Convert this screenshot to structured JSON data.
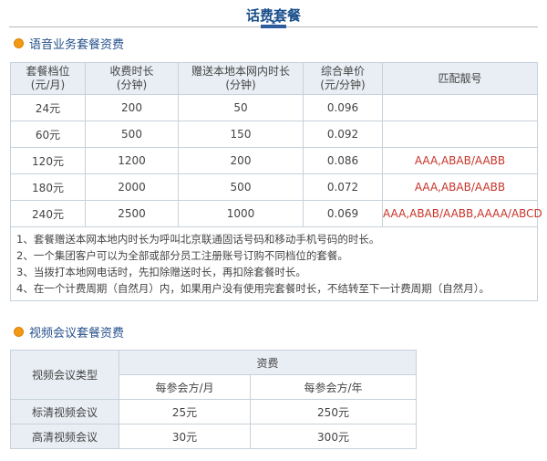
{
  "page_title": "话费套餐",
  "voice_section": {
    "title": "语音业务套餐资费",
    "headers": [
      [
        "套餐档位",
        "(元/月)"
      ],
      [
        "收费时长",
        "(分钟)"
      ],
      [
        "赠送本地本网内时长",
        "(分钟)"
      ],
      [
        "综合单价",
        "(元/分钟)"
      ],
      [
        "匹配靓号"
      ]
    ],
    "rows": [
      {
        "tier": "24元",
        "minutes": "200",
        "bonus": "50",
        "price": "0.096",
        "numbers": ""
      },
      {
        "tier": "60元",
        "minutes": "500",
        "bonus": "150",
        "price": "0.092",
        "numbers": ""
      },
      {
        "tier": "120元",
        "minutes": "1200",
        "bonus": "200",
        "price": "0.086",
        "numbers": "AAA,ABAB/AABB"
      },
      {
        "tier": "180元",
        "minutes": "2000",
        "bonus": "500",
        "price": "0.072",
        "numbers": "AAA,ABAB/AABB"
      },
      {
        "tier": "240元",
        "minutes": "2500",
        "bonus": "1000",
        "price": "0.069",
        "numbers": "AAA,ABAB/AABB,AAAA/ABCD"
      }
    ],
    "notes": [
      "1、套餐赠送本网本地内时长为呼叫北京联通固话号码和移动手机号码的时长。",
      "2、一个集团客户可以为全部或部分员工注册账号订购不同档位的套餐。",
      "3、当拨打本地网电话时，先扣除赠送时长，再扣除套餐时长。",
      "4、在一个计费周期（自然月）内，如果用户没有使用完套餐时长，不结转至下一计费周期（自然月）。"
    ]
  },
  "video_section": {
    "title": "视频会议套餐资费",
    "type_header": "视频会议类型",
    "fee_header": "资费",
    "sub_headers": [
      "每参会方/月",
      "每参会方/年"
    ],
    "rows": [
      {
        "type": "标清视频会议",
        "month": "25元",
        "year": "250元"
      },
      {
        "type": "高清视频会议",
        "month": "30元",
        "year": "300元"
      }
    ]
  },
  "colors": {
    "title": "#1a4f8b",
    "accent_dot": "#f39a12",
    "highlight_text": "#c6352a",
    "header_bg": "#e9eef4"
  }
}
